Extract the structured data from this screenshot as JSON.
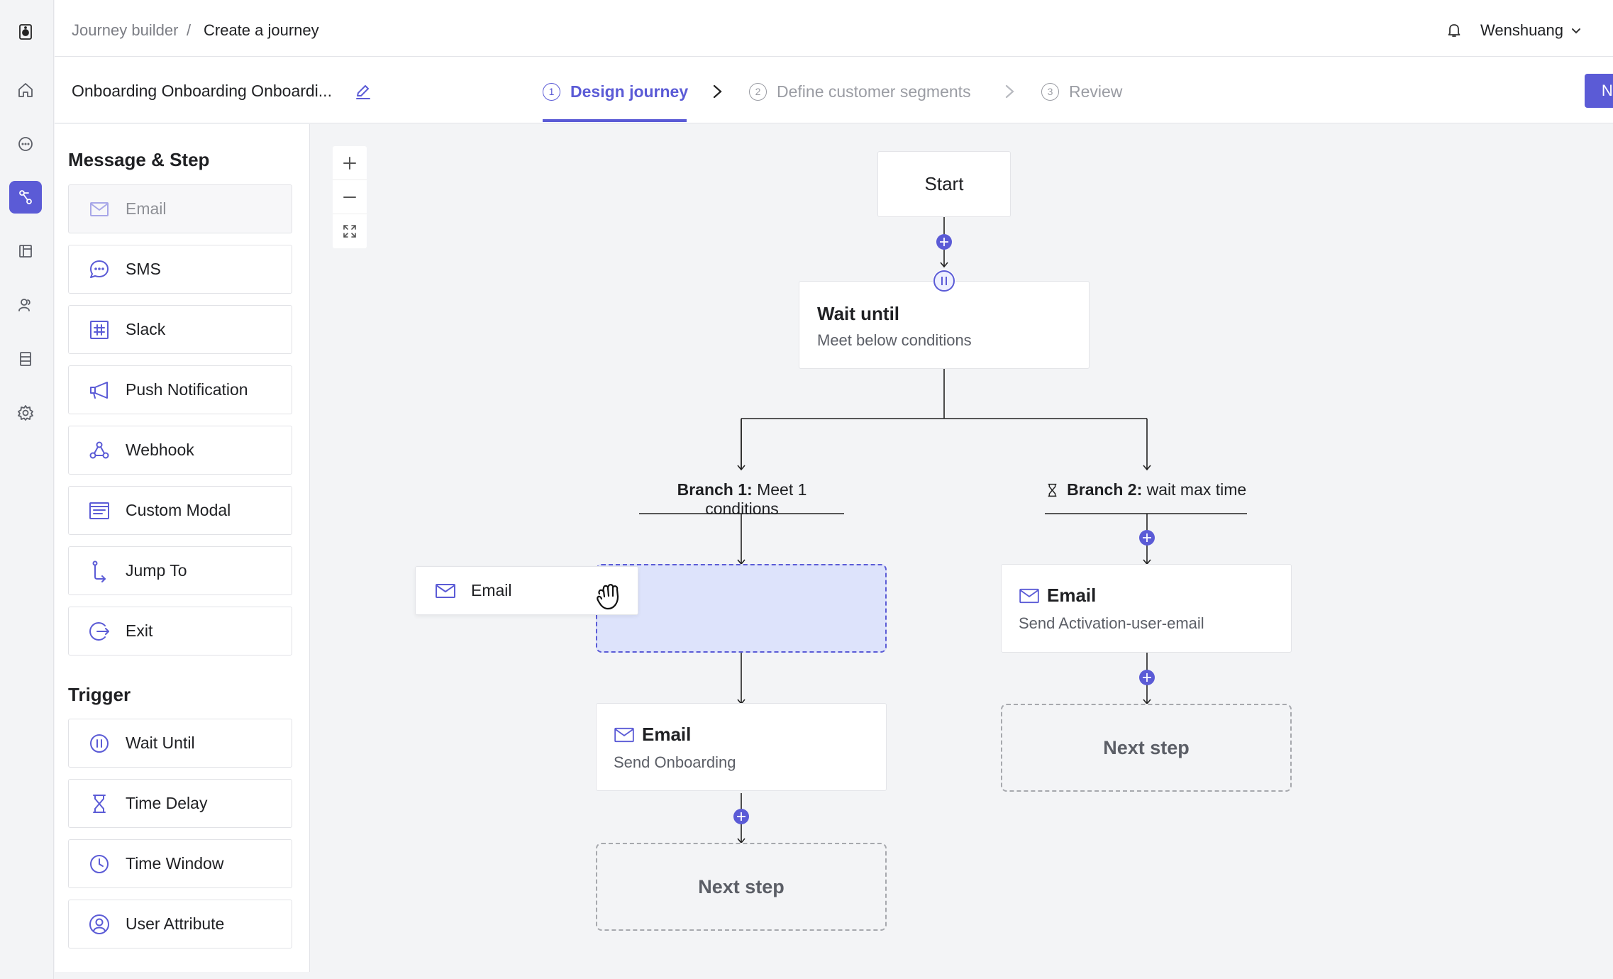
{
  "breadcrumb": {
    "parent": "Journey builder",
    "separator": "/",
    "current": "Create a journey"
  },
  "user": {
    "name": "Wenshuang"
  },
  "journey": {
    "name": "Onboarding Onboarding Onboardi..."
  },
  "steps": [
    {
      "num": "1",
      "label": "Design journey",
      "active": true
    },
    {
      "num": "2",
      "label": "Define customer segments",
      "active": false
    },
    {
      "num": "3",
      "label": "Review",
      "active": false
    }
  ],
  "next_button": "Next",
  "sidebar": {
    "message_title": "Message & Step",
    "message_items": [
      {
        "label": "Email",
        "icon": "envelope-icon"
      },
      {
        "label": "SMS",
        "icon": "chat-bubble-icon"
      },
      {
        "label": "Slack",
        "icon": "slack-icon"
      },
      {
        "label": "Push Notification",
        "icon": "megaphone-icon"
      },
      {
        "label": "Webhook",
        "icon": "webhook-icon"
      },
      {
        "label": "Custom Modal",
        "icon": "modal-icon"
      },
      {
        "label": "Jump To",
        "icon": "jump-icon"
      },
      {
        "label": "Exit",
        "icon": "exit-icon"
      }
    ],
    "trigger_title": "Trigger",
    "trigger_items": [
      {
        "label": "Wait Until",
        "icon": "pause-circle-icon"
      },
      {
        "label": "Time Delay",
        "icon": "hourglass-icon"
      },
      {
        "label": "Time Window",
        "icon": "clock-icon"
      },
      {
        "label": "User Attribute",
        "icon": "user-circle-icon"
      }
    ]
  },
  "canvas": {
    "start": "Start",
    "wait": {
      "title": "Wait until",
      "subtitle": "Meet below conditions"
    },
    "branch1": {
      "prefix": "Branch 1:",
      "text": "Meet 1 conditions"
    },
    "branch2": {
      "prefix": "Branch 2:",
      "text": "wait max time"
    },
    "dragging": {
      "label": "Email"
    },
    "email1": {
      "title": "Email",
      "subtitle": "Send Onboarding"
    },
    "email2": {
      "title": "Email",
      "subtitle": "Send Activation-user-email"
    },
    "next_step_1": "Next step",
    "next_step_2": "Next step"
  },
  "colors": {
    "accent": "#5b5bd6",
    "drop_zone": "#dde3fb",
    "background": "#f3f4f6"
  }
}
